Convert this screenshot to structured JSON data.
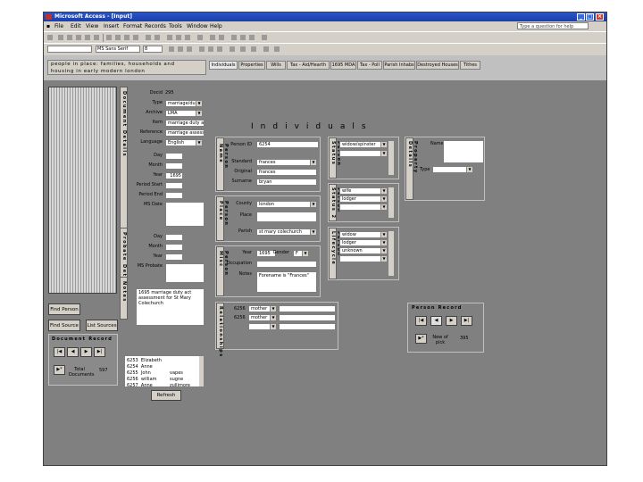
{
  "window": {
    "title": "Microsoft Access - [Input]"
  },
  "menu": [
    "File",
    "Edit",
    "View",
    "Insert",
    "Format",
    "Records",
    "Tools",
    "Window",
    "Help"
  ],
  "help_placeholder": "Type a question for help",
  "toolbar": {
    "font": "MS Sans Serif",
    "size": "8"
  },
  "caption": {
    "line1": "people in place: families, households and",
    "line2": "housing in early modern london"
  },
  "tabs": [
    "Individuals",
    "Properties",
    "Wills",
    "Tax - Aid/Hearth",
    "1695 MDA",
    "Tax - Poll",
    "Parish Inhabs",
    "Destroyed Houses",
    "Tithes"
  ],
  "document": {
    "section_label": "Document Details",
    "fields": {
      "docid_label": "Docid",
      "docid_value": "295",
      "type_label": "Type",
      "type_value": "marriage/dues",
      "archive_label": "Archive",
      "archive_value": "LMA",
      "item_label": "Item",
      "item_value": "marriage duty assessments",
      "reference_label": "Reference",
      "reference_value": "marriage assessments 1695",
      "language_label": "Language",
      "language_value": "English",
      "day_label": "Day",
      "month_label": "Month",
      "year_label": "Year",
      "year_value": "1695",
      "period_start_label": "Period Start",
      "period_end_label": "Period End",
      "ms_date_label": "MS Date"
    },
    "probate_label": "Probate Details",
    "probate": {
      "day_label": "Day",
      "month_label": "Month",
      "year_label": "Year",
      "ms_probate_label": "MS Probate"
    },
    "notes_label": "Notes",
    "notes_value": "1695 marriage duty act assessment for St Mary Colechurch"
  },
  "buttons": {
    "find_person": "Find Person",
    "find_source": "Find Source",
    "list_sources": "List Sources",
    "refresh": "Refresh"
  },
  "document_record": {
    "title": "Document Record",
    "total_label": "Total Documents",
    "total_value": "597"
  },
  "person_list": [
    {
      "id": "6253",
      "first": "Elizabeth",
      "last": ""
    },
    {
      "id": "6254",
      "first": "Anne",
      "last": ""
    },
    {
      "id": "6255",
      "first": "John",
      "last": "vapes"
    },
    {
      "id": "6256",
      "first": "william",
      "last": "sugne"
    },
    {
      "id": "6257",
      "first": "Anne",
      "last": "zullimore"
    }
  ],
  "individuals": {
    "title": "Individuals",
    "person_id_label": "Person ID",
    "person_id_value": "6254",
    "person_name_label": "Person Name",
    "standard_label": "Standard",
    "standard_value": "frances",
    "original_label": "Original",
    "original_value": "frances",
    "surname_label": "Surname",
    "surname_value": "bryan",
    "person_place_label": "Person Place",
    "county_label": "County",
    "county_value": "london",
    "place_label": "Place",
    "place_value": "",
    "parish_label": "Parish",
    "parish_value": "st mary colechurch",
    "person_misc_label": "Person Misc",
    "year_label": "Year",
    "year_value": "1695",
    "gender_label": "Gender",
    "gender_value": "F",
    "occupation_label": "Occupation",
    "occupation_value": "",
    "notes_label": "Notes",
    "notes_value": "Forename is \"Frances\""
  },
  "person_status": {
    "label": "Person Status",
    "items": [
      "widow/spinster"
    ]
  },
  "person_status_2": {
    "label": "Person Status 2",
    "items": [
      "wife",
      "lodger"
    ]
  },
  "person_lifecycle": {
    "label": "Person Lifecycle",
    "items": [
      "widow",
      "lodger",
      "unknown"
    ]
  },
  "property_details": {
    "label": "Property Details",
    "name_label": "Name",
    "type_label": "Type"
  },
  "relationships": {
    "label": "Relationships",
    "rows": [
      {
        "id": "6256",
        "rel": "mother"
      },
      {
        "id": "6256",
        "rel": "mother"
      }
    ]
  },
  "person_record": {
    "title": "Person Record",
    "new_label": "New of pick",
    "count_value": "395"
  }
}
